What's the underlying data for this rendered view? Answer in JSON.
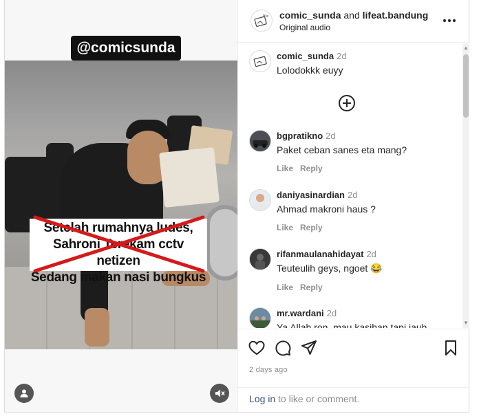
{
  "video": {
    "handle_tag": "@comicsunda",
    "caption_lines": [
      "Setelah rumahnya ludes,",
      "Sahroni Terekam cctv netizen",
      "Sedang makan nasi bungkus"
    ],
    "profile_icon": "user-icon",
    "mute_icon": "speaker-muted-icon"
  },
  "header": {
    "user1": "comic_sunda",
    "and_text": "and",
    "user2": "lifeat.bandung",
    "subtitle": "Original audio",
    "more_icon": "more-dots-icon"
  },
  "comments": [
    {
      "user": "comic_sunda",
      "time": "2d",
      "text": "Lolodokkk euyy",
      "actions": false
    },
    {
      "user": "bgpratikno",
      "time": "2d",
      "text": "Paket ceban sanes eta mang?",
      "like": "Like",
      "reply": "Reply"
    },
    {
      "user": "daniyasinardian",
      "time": "2d",
      "text": "Ahmad makroni haus ?",
      "like": "Like",
      "reply": "Reply"
    },
    {
      "user": "rifanmaulanahidayat",
      "time": "2d",
      "text": "Teuteulih geys, ngoet 😂",
      "like": "Like",
      "reply": "Reply"
    },
    {
      "user": "mr.wardani",
      "time": "2d",
      "text": "Ya Allah ron, mau kasihan tapi jauh"
    }
  ],
  "footer": {
    "date": "2 days ago",
    "login_link": "Log in",
    "login_rest": " to like or comment."
  },
  "colors": {
    "link": "#385185",
    "muted": "#8e8e8e",
    "text": "#262626",
    "strike": "#d41a1a"
  }
}
